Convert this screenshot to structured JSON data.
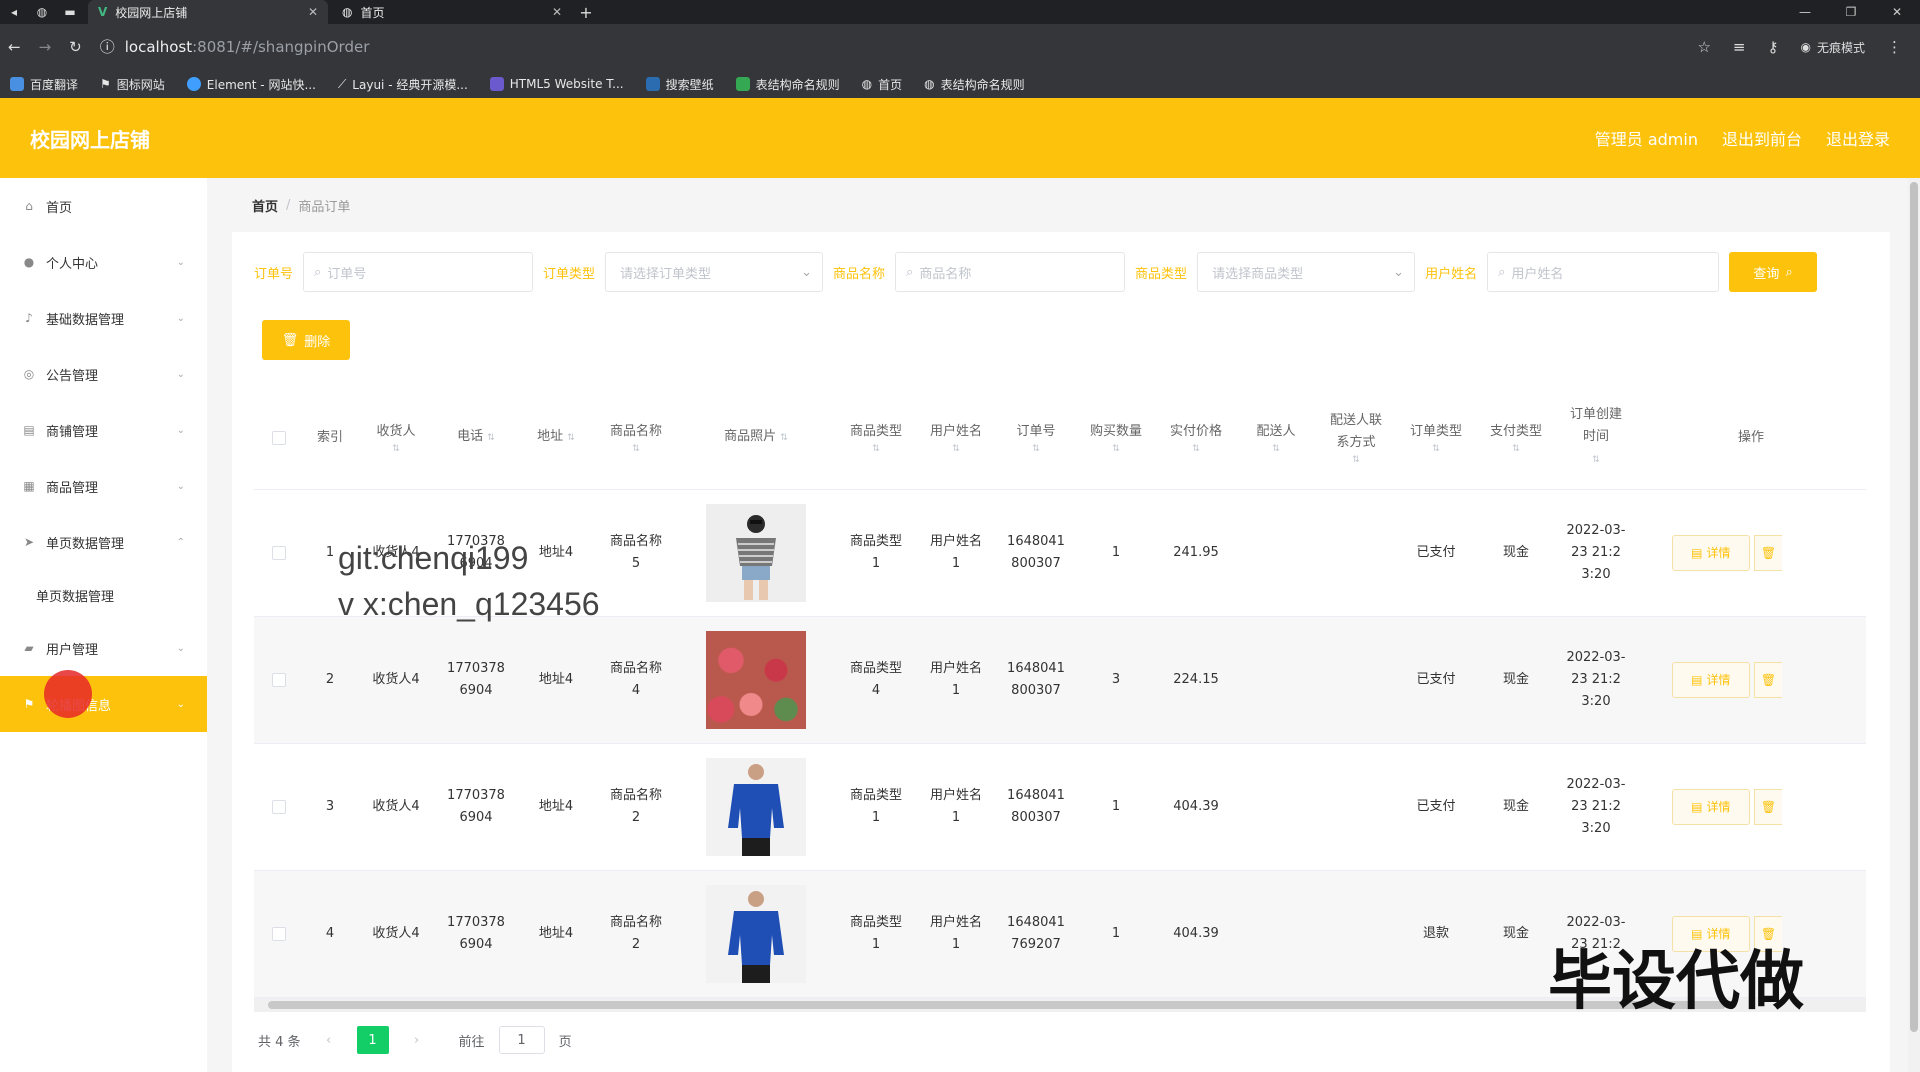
{
  "browser": {
    "tabs": [
      {
        "title": "校园网上店铺",
        "active": true
      },
      {
        "title": "首页",
        "active": false
      }
    ],
    "url": "localhost:8081/#/shangpinOrder",
    "url_host": "localhost",
    "url_rest": ":8081/#/shangpinOrder",
    "incognito_label": "无痕模式",
    "bookmarks": [
      "百度翻译",
      "图标网站",
      "Element - 网站快...",
      "Layui - 经典开源模...",
      "HTML5 Website T...",
      "搜索壁纸",
      "表结构命名规则",
      "首页",
      "表结构命名规则"
    ]
  },
  "header": {
    "brand": "校园网上店铺",
    "links": [
      "管理员 admin",
      "退出到前台",
      "退出登录"
    ]
  },
  "sidebar": {
    "items": [
      {
        "label": "首页",
        "icon": "home-icon"
      },
      {
        "label": "个人中心",
        "icon": "user-icon"
      },
      {
        "label": "基础数据管理",
        "icon": "mic-icon"
      },
      {
        "label": "公告管理",
        "icon": "compass-icon"
      },
      {
        "label": "商铺管理",
        "icon": "message-icon"
      },
      {
        "label": "商品管理",
        "icon": "grid-icon"
      },
      {
        "label": "单页数据管理",
        "icon": "send-icon"
      },
      {
        "label": "单页数据管理",
        "icon": "none"
      },
      {
        "label": "用户管理",
        "icon": "folder-icon"
      },
      {
        "label": "轮播图信息",
        "icon": "flag-icon"
      }
    ]
  },
  "breadcrumb": {
    "home": "首页",
    "current": "商品订单"
  },
  "filters": {
    "order_no_label": "订单号",
    "order_no_placeholder": "订单号",
    "order_type_label": "订单类型",
    "order_type_placeholder": "请选择订单类型",
    "goods_name_label": "商品名称",
    "goods_name_placeholder": "商品名称",
    "goods_type_label": "商品类型",
    "goods_type_placeholder": "请选择商品类型",
    "user_name_label": "用户姓名",
    "user_name_placeholder": "用户姓名",
    "query_label": "查询"
  },
  "delete_label": "删除",
  "table": {
    "headers": [
      "索引",
      "收货人",
      "电话",
      "地址",
      "商品名称",
      "商品照片",
      "商品类型",
      "用户姓名",
      "订单号",
      "购买数量",
      "实付价格",
      "配送人",
      "配送人联系方式",
      "订单类型",
      "支付类型",
      "订单创建时间",
      "操作"
    ],
    "rows": [
      {
        "idx": "1",
        "receiver": "收货人4",
        "phone": "17703786904",
        "address": "地址4",
        "goods": "商品名称5",
        "goods_type": "商品类型1",
        "user": "用户姓名1",
        "order_no": "1648041800307",
        "qty": "1",
        "price": "241.95",
        "courier": "",
        "courier_phone": "",
        "order_type": "已支付",
        "pay_type": "现金",
        "created": "2022-03-23 21:23:20",
        "photo": "p1"
      },
      {
        "idx": "2",
        "receiver": "收货人4",
        "phone": "17703786904",
        "address": "地址4",
        "goods": "商品名称4",
        "goods_type": "商品类型4",
        "user": "用户姓名1",
        "order_no": "1648041800307",
        "qty": "3",
        "price": "224.15",
        "courier": "",
        "courier_phone": "",
        "order_type": "已支付",
        "pay_type": "现金",
        "created": "2022-03-23 21:23:20",
        "photo": "p2"
      },
      {
        "idx": "3",
        "receiver": "收货人4",
        "phone": "17703786904",
        "address": "地址4",
        "goods": "商品名称2",
        "goods_type": "商品类型1",
        "user": "用户姓名1",
        "order_no": "1648041800307",
        "qty": "1",
        "price": "404.39",
        "courier": "",
        "courier_phone": "",
        "order_type": "已支付",
        "pay_type": "现金",
        "created": "2022-03-23 21:23:20",
        "photo": "p3"
      },
      {
        "idx": "4",
        "receiver": "收货人4",
        "phone": "17703786904",
        "address": "地址4",
        "goods": "商品名称2",
        "goods_type": "商品类型1",
        "user": "用户姓名1",
        "order_no": "1648041769207",
        "qty": "1",
        "price": "404.39",
        "courier": "",
        "courier_phone": "",
        "order_type": "退款",
        "pay_type": "现金",
        "created": "2022-03-23 21:2",
        "photo": "p3"
      }
    ],
    "detail_label": "详情"
  },
  "pagination": {
    "total": "共 4 条",
    "current": "1",
    "goto_prefix": "前往",
    "goto_value": "1",
    "goto_suffix": "页"
  },
  "overlay": {
    "line1": "git:chenqi199",
    "line2": "v x:chen_q123456",
    "watermark": "毕设代做"
  },
  "colors": {
    "accent": "#fdc20b",
    "pager_active": "#13ce66"
  }
}
